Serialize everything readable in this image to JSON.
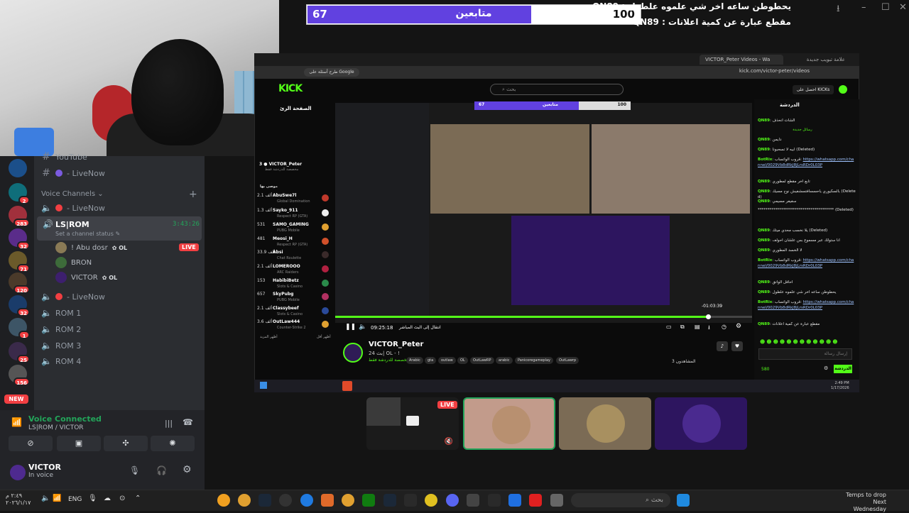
{
  "overlay": {
    "goal_current": "67",
    "goal_label": "متابعين",
    "goal_target": "100",
    "goal_progress": 0.67,
    "ticker_line1": "يحطوطن ساعه اخر شي علموه علطول : QN89",
    "ticker_line2": "مقطع عبارة عن كمية اعلانات : QN89"
  },
  "discord": {
    "channels_top": [
      {
        "name": "YouTube"
      },
      {
        "name": "- LiveNow"
      }
    ],
    "voice_channels_header": "Voice Channels",
    "voice_channels": [
      {
        "name": "- LiveNow"
      },
      {
        "name": "LS|ROM",
        "timer": "3:43:26",
        "status": "Set a channel status"
      },
      {
        "name": "- LiveNow"
      },
      {
        "name": "ROM 1"
      },
      {
        "name": "ROM 2"
      },
      {
        "name": "ROM 3"
      },
      {
        "name": "ROM 4"
      }
    ],
    "users": [
      {
        "name": "! Abu dosr",
        "tag": "OL",
        "live": "LIVE"
      },
      {
        "name": "BRON"
      },
      {
        "name": "VICTOR",
        "tag": "OL"
      }
    ],
    "server_badges": [
      "2",
      "283",
      "32",
      "71",
      "120",
      "32",
      "1",
      "25",
      "156",
      "NEW"
    ],
    "voice_status": "Voice Connected",
    "voice_location": "LS|ROM / VICTOR",
    "me_name": "VICTOR",
    "me_status": "In voice"
  },
  "browser": {
    "tab_active": "VICTOR_Peter Videos - Wa",
    "tab_other": "علامة تبويب جديدة",
    "url": "kick.com/victor-peter/videos",
    "bookmark": "طرح أسئلة على Google",
    "kick_logo": "KICK",
    "search_placeholder": "بحث",
    "login_label": "احصل على KICKs",
    "home_label": "الصفحة الرئ"
  },
  "kick_sidebar": {
    "following_label": "VICTOR_Peter",
    "following_sub": "مخصصة للدردشة فقط",
    "following_count": "3",
    "recommended_label": "موصى بها",
    "items": [
      {
        "viewers": "2.1 ألف",
        "name": "AbuSwe7l",
        "game": "Global Domination"
      },
      {
        "viewers": "1.3 ألف",
        "name": "Sayko_911",
        "game": "Respect RP (GTA)"
      },
      {
        "viewers": "531",
        "name": "SAMO_GAMING",
        "game": "PUBG Mobile"
      },
      {
        "viewers": "481",
        "name": "Meosi_H",
        "game": "Respect RP (GTA)"
      },
      {
        "viewers": "33.9 ألف",
        "name": "Absi",
        "game": "Chat Roulette"
      },
      {
        "viewers": "2.1 ألف",
        "name": "LOMEROOO",
        "game": "ARC Raiders"
      },
      {
        "viewers": "153",
        "name": "HabibiBetz",
        "game": "Slots & Casino"
      },
      {
        "viewers": "657",
        "name": "SkyPubg",
        "game": "PUBG Mobile"
      },
      {
        "viewers": "2.1 ألف",
        "name": "Classybeef",
        "game": "Slots & Casino"
      },
      {
        "viewers": "3.6 ألف",
        "name": "OutLaw444",
        "game": "Counter-Strike 2"
      }
    ],
    "show_more": "أظهر المزيد",
    "show_less": "أظهر أقل"
  },
  "player": {
    "mini_goal_left": "67",
    "mini_goal_mid": "متابعين",
    "mini_goal_right": "100",
    "current_time": "09:25:18",
    "go_live": "انتقال إلى البث المباشر",
    "remaining": "-01:03:39",
    "progress": 0.9
  },
  "stream_info": {
    "streamer": "VICTOR_Peter",
    "title": "بث 24| OL - !",
    "category": "مخصصة للدردشة فقط",
    "tags": [
      "Arabic",
      "gta",
      "outlaw",
      "OL",
      "OutLawRP",
      "arabic",
      "Panicoregameplay",
      "OutLawrp"
    ],
    "viewers": "المشاهدون 3"
  },
  "chat": {
    "title": "الدردشة",
    "new_messages": "رسائل جديدة",
    "messages": [
      {
        "user": "QN89",
        "text": "الشات انحذف"
      },
      {
        "user": "QN89",
        "text": "دايمن"
      },
      {
        "user": "QN89",
        "text": "ابيه لا تسحبونا (Deleted)"
      },
      {
        "user": "BotRix",
        "text": "قروب الواتساب:",
        "link": "https://whatsapp.com/channel/0029Vb8dRkJ8jLrsRDr0L03P"
      },
      {
        "user": "QN89",
        "text": "تابع اخر مقطع لمطوري"
      },
      {
        "user": "QN89",
        "text": "بالسكيوري ياحسسافتسشفيش نوح مسيك (Deleted)"
      },
      {
        "user": "QN89",
        "text": "سفيفر مسيمي"
      },
      {
        "user": "",
        "text": "*************************************** (Deleted)"
      },
      {
        "user": "QN89",
        "text": "يلا نخسب محدي ميتك (Deleted)"
      },
      {
        "user": "QN89",
        "text": "انا ستولك عبر مسموع بس علشان احولف"
      },
      {
        "user": "QN89",
        "text": "لا الخسد المطوري"
      },
      {
        "user": "BotRix",
        "text": "قروب الواتساب:",
        "link": "https://whatsapp.com/channel/0029Vb8dRkJ8jLrsRDr0L03P"
      },
      {
        "user": "QN89",
        "text": "احافل الواتق"
      },
      {
        "user": "QN89",
        "text": "يحطوطن ساعه اخر شي علموه علطول"
      },
      {
        "user": "BotRix",
        "text": "قروب الواتساب:",
        "link": "https://whatsapp.com/channel/0029Vb8dRkJ8jLrsRDr0L03P"
      },
      {
        "user": "QN89",
        "text": "مقطع عبارة عن كمية اعلانات"
      }
    ],
    "input_placeholder": "إرسال رسالة",
    "send_label": "الدردشة",
    "points": "580"
  },
  "inner_taskbar": {
    "time": "2:49 PM",
    "date": "1/17/2026"
  },
  "stream_tiles": {
    "live_label": "LIVE"
  },
  "taskbar": {
    "time": "٢:٤٩ م",
    "date": "٢٠٢٦/١/١٧",
    "lang": "ENG",
    "search_placeholder": "بحث",
    "weather_title": "Temps to drop",
    "weather_sub": "Next Wednesday"
  },
  "colors": {
    "kick_green": "#53fc18",
    "discord_red": "#f23f42",
    "discord_green": "#23a55a",
    "purple": "#6141e0"
  }
}
